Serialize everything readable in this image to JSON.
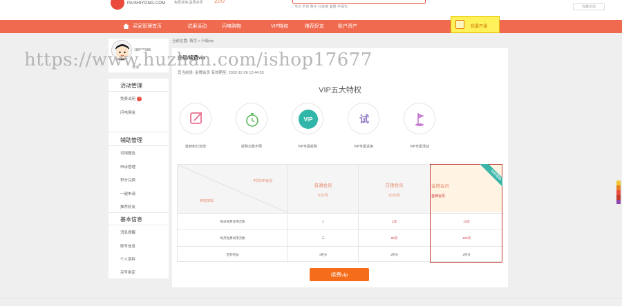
{
  "header": {
    "logo_text": "PAISHIYONG.COM",
    "slogan": "免费试用 品质点评",
    "promo_number": "200",
    "hot_words": "毛巾 手表 鞋子 打底裤 面膜 手提包",
    "right_link": "收藏本站"
  },
  "nav": {
    "items": [
      "买家管理首页",
      "试用活动",
      "闪电购物",
      "VIP特权",
      "推荐好友",
      "账户资产"
    ],
    "vip_button_label": "我要开通"
  },
  "sidebar": {
    "username": "189****886",
    "user_badge": "普通",
    "groups": [
      {
        "title": "活动管理",
        "items": [
          "免费试用",
          "闪电佣金"
        ],
        "badge": "?"
      },
      {
        "title": "辅助管理",
        "items": [
          "试用报告",
          "申诉管理",
          "积分兑换",
          "一键申请",
          "推荐好友"
        ]
      },
      {
        "title": "基本信息",
        "items": [
          "消息提醒",
          "账号信息",
          "个人资料",
          "买号绑定"
        ]
      }
    ]
  },
  "breadcrumb": "当前位置: 首页 > 升级vip",
  "main": {
    "title": "升级/续费vip",
    "subtitle": "您当前是: 金牌会员   有效期至: 2032-12-26 12:44:53",
    "section_title": "VIP五大特权",
    "features": [
      {
        "icon": "edit-icon",
        "label": "签到积分加倍",
        "color": "#e8708f"
      },
      {
        "icon": "stopwatch-icon",
        "label": "抢购次数不限",
        "color": "#5cb85c"
      },
      {
        "icon": "vip-icon",
        "label": "VIP专属抢购",
        "color": "#2fb6a8"
      },
      {
        "icon": "trial-icon",
        "label": "VIP专属试用",
        "color": "#8e7cc3"
      },
      {
        "icon": "flag-icon",
        "label": "VIP专属活动",
        "color": "#c77dd1"
      }
    ],
    "table": {
      "diag_top": "不同VIP级别",
      "diag_bottom": "特权体现",
      "columns": [
        {
          "name": "普通会员",
          "price": "0元/月"
        },
        {
          "name": "白银会员",
          "price": "10元/月"
        },
        {
          "name": "金牌会员",
          "price": "金牌会员"
        }
      ],
      "ribbon": "当前等级",
      "rows": [
        {
          "label": "每日免费试用次数",
          "values": [
            "2",
            "2次",
            "10次"
          ]
        },
        {
          "label": "每月免费试用次数",
          "values": [
            "三",
            "80次",
            "100次"
          ]
        },
        {
          "label": "签到奖励",
          "values": [
            "1积分",
            "1积分",
            "1积分"
          ]
        }
      ]
    },
    "renew_button": "续费vip"
  },
  "watermark": "https://www.huzhan.com/ishop17677",
  "colors": {
    "brand_red": "#f06a4f",
    "button_orange": "#f56c1b",
    "ribbon_teal": "#3ab5a8"
  }
}
